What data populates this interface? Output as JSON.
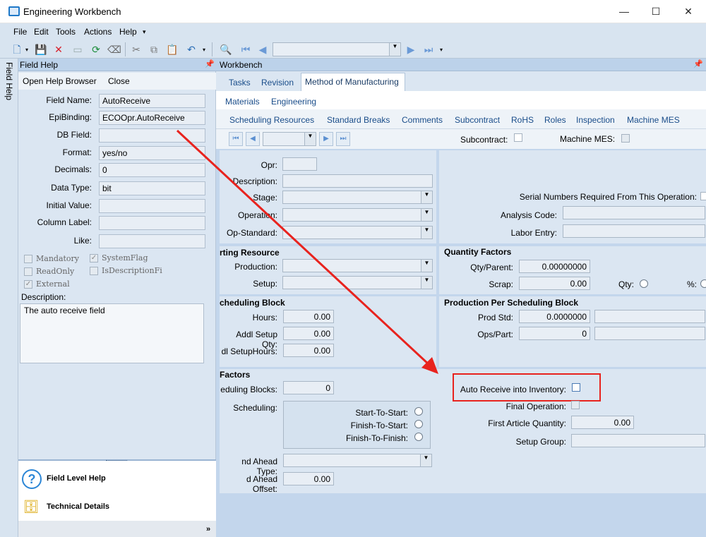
{
  "window": {
    "title": "Engineering Workbench",
    "minimize": "—",
    "maximize": "☐",
    "close": "✕"
  },
  "menu": [
    "File",
    "Edit",
    "Tools",
    "Actions",
    "Help"
  ],
  "field_help": {
    "side_tab": "Field Help",
    "title": "Field Help",
    "toolbar": {
      "open_browser": "Open Help Browser",
      "close": "Close"
    },
    "fields": {
      "field_name": {
        "label": "Field Name:",
        "value": "AutoReceive"
      },
      "epibinding": {
        "label": "EpiBinding:",
        "value": "ECOOpr.AutoReceive"
      },
      "db_field": {
        "label": "DB Field:",
        "value": ""
      },
      "format": {
        "label": "Format:",
        "value": "yes/no"
      },
      "decimals": {
        "label": "Decimals:",
        "value": "0"
      },
      "data_type": {
        "label": "Data Type:",
        "value": "bit"
      },
      "initial_value": {
        "label": "Initial Value:",
        "value": ""
      },
      "column_label": {
        "label": "Column Label:",
        "value": ""
      },
      "like": {
        "label": "Like:",
        "value": ""
      }
    },
    "flags": {
      "mandatory": "Mandatory",
      "system_flag": "SystemFlag",
      "read_only": "ReadOnly",
      "is_description": "IsDescriptionFi",
      "external": "External"
    },
    "description_label": "Description:",
    "description_value": "The auto receive field",
    "bottom": {
      "field_level_help": "Field Level Help",
      "technical_details": "Technical Details"
    }
  },
  "workbench": {
    "title": "Workbench",
    "tabs": [
      "Tasks",
      "Revision",
      "Method of Manufacturing"
    ],
    "subtabs": [
      "Materials",
      "Engineering"
    ],
    "sections": [
      "Scheduling Resources",
      "Standard Breaks",
      "Comments",
      "Subcontract",
      "RoHS",
      "Roles",
      "Inspection",
      "Machine MES"
    ],
    "subcontract_label": "Subcontract:",
    "machine_mes_label": "Machine MES:",
    "opr_labels": {
      "opr": "Opr:",
      "description": "Description:",
      "stage": "Stage:",
      "operation": "Operation:",
      "op_standard": "Op-Standard:"
    },
    "serial_numbers_label": "Serial Numbers Required From This Operation:",
    "analysis_code_label": "Analysis Code:",
    "labor_entry_label": "Labor Entry:",
    "starting_resource": {
      "title": "rting Resource",
      "production": "Production:",
      "setup": "Setup:"
    },
    "quantity_factors": {
      "title": "Quantity Factors",
      "qty_parent_label": "Qty/Parent:",
      "qty_parent_value": "0.00000000",
      "scrap_label": "Scrap:",
      "scrap_value": "0.00",
      "qty_label": "Qty:",
      "pct_label": "%:"
    },
    "scheduling_block": {
      "title": "cheduling Block",
      "hours_label": "Hours:",
      "hours_value": "0.00",
      "addl_setup_qty_label": "Addl Setup Qty:",
      "addl_setup_qty_value": "0.00",
      "addl_setup_hours_label": "dl SetupHours:",
      "addl_setup_hours_value": "0.00"
    },
    "production_per_block": {
      "title": "Production Per Scheduling Block",
      "prod_std_label": "Prod Std:",
      "prod_std_value": "0.0000000",
      "ops_part_label": "Ops/Part:",
      "ops_part_value": "0"
    },
    "factors": {
      "title": "Factors",
      "sched_blocks_label": "eduling Blocks:",
      "sched_blocks_value": "0",
      "scheduling_label": "Scheduling:",
      "start_to_start": "Start-To-Start:",
      "finish_to_start": "Finish-To-Start:",
      "finish_to_finish": "Finish-To-Finish:",
      "ahead_type_label": "nd Ahead Type:",
      "ahead_offset_label": "d Ahead Offset:",
      "ahead_offset_value": "0.00"
    },
    "auto_receive_label": "Auto Receive into Inventory:",
    "final_operation_label": "Final Operation:",
    "first_article_label": "First Article Quantity:",
    "first_article_value": "0.00",
    "setup_group_label": "Setup Group:"
  }
}
